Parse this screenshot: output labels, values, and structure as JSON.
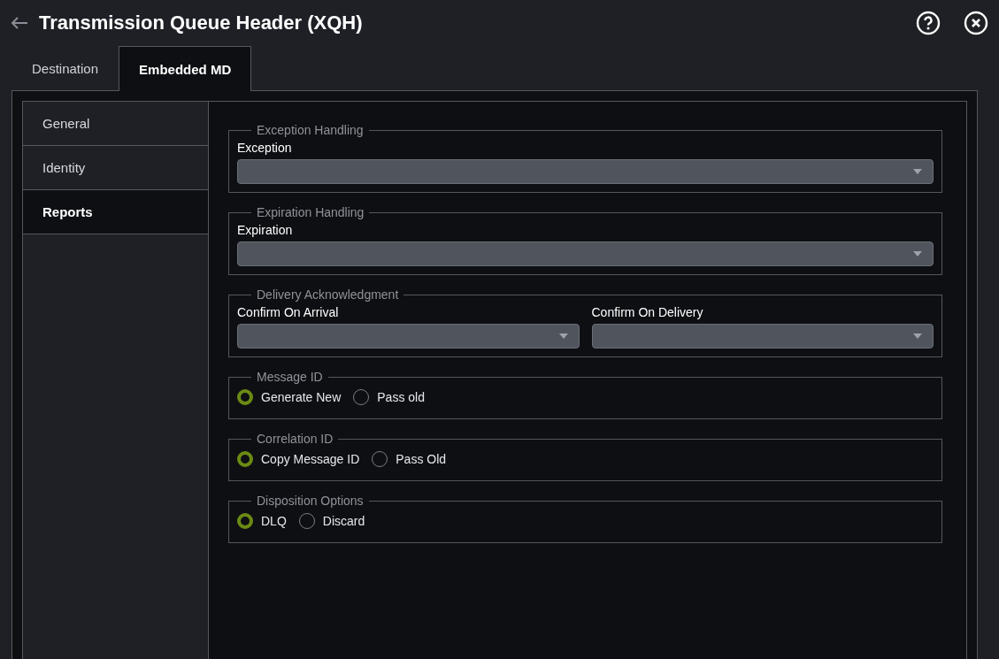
{
  "header": {
    "title": "Transmission Queue Header (XQH)"
  },
  "tabs": [
    {
      "label": "Destination",
      "selected": false
    },
    {
      "label": "Embedded MD",
      "selected": true
    }
  ],
  "sidebar": {
    "items": [
      {
        "label": "General",
        "selected": false
      },
      {
        "label": "Identity",
        "selected": false
      },
      {
        "label": "Reports",
        "selected": true
      }
    ]
  },
  "sections": [
    {
      "legend": "Exception Handling",
      "kind": "selects",
      "fields": [
        {
          "label": "Exception"
        }
      ]
    },
    {
      "legend": "Expiration Handling",
      "kind": "selects",
      "fields": [
        {
          "label": "Expiration"
        }
      ]
    },
    {
      "legend": "Delivery Acknowledgment",
      "kind": "selects",
      "fields": [
        {
          "label": "Confirm On Arrival"
        },
        {
          "label": "Confirm On Delivery"
        }
      ]
    },
    {
      "legend": "Message ID",
      "kind": "radios",
      "options": [
        {
          "label": "Generate New",
          "selected": true
        },
        {
          "label": "Pass old",
          "selected": false
        }
      ]
    },
    {
      "legend": "Correlation ID",
      "kind": "radios",
      "options": [
        {
          "label": "Copy Message ID",
          "selected": true
        },
        {
          "label": "Pass Old",
          "selected": false
        }
      ]
    },
    {
      "legend": "Disposition Options",
      "kind": "radios",
      "options": [
        {
          "label": "DLQ",
          "selected": true
        },
        {
          "label": "Discard",
          "selected": false
        }
      ]
    }
  ]
}
